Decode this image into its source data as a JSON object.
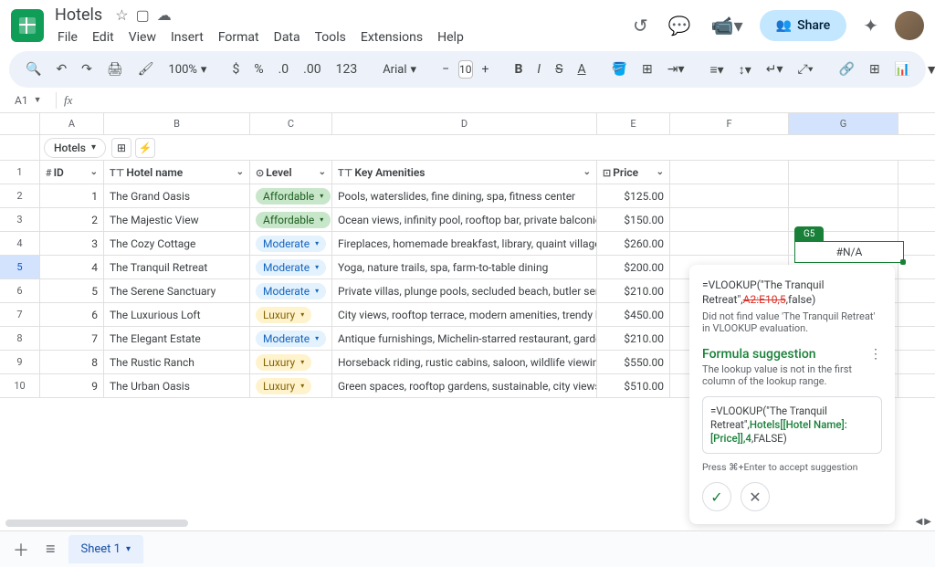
{
  "doc": {
    "title": "Hotels"
  },
  "menu": [
    "File",
    "Edit",
    "View",
    "Insert",
    "Format",
    "Data",
    "Tools",
    "Extensions",
    "Help"
  ],
  "topbar": {
    "share": "Share"
  },
  "toolbar": {
    "zoom": "100%",
    "font": "Arial",
    "fontsize": "10"
  },
  "namebox": {
    "ref": "A1"
  },
  "columns": [
    "A",
    "B",
    "C",
    "D",
    "E",
    "F",
    "G"
  ],
  "table_chip": "Hotels",
  "headers": {
    "id": "ID",
    "name": "Hotel name",
    "level": "Level",
    "amen": "Key Amenities",
    "price": "Price"
  },
  "rows": [
    {
      "n": "2",
      "id": "1",
      "name": "The Grand Oasis",
      "level": "Affordable",
      "lvl": "aff",
      "amen": "Pools, waterslides, fine dining, spa, fitness center",
      "price": "$125.00"
    },
    {
      "n": "3",
      "id": "2",
      "name": "The Majestic View",
      "level": "Affordable",
      "lvl": "aff",
      "amen": "Ocean views, infinity pool, rooftop bar, private balconies",
      "price": "$150.00"
    },
    {
      "n": "4",
      "id": "3",
      "name": "The Cozy Cottage",
      "level": "Moderate",
      "lvl": "mod",
      "amen": "Fireplaces, homemade breakfast, library, quaint village charm",
      "price": "$260.00"
    },
    {
      "n": "5",
      "id": "4",
      "name": "The Tranquil Retreat",
      "level": "Moderate",
      "lvl": "mod",
      "amen": "Yoga, nature trails, spa, farm-to-table dining",
      "price": "$200.00"
    },
    {
      "n": "6",
      "id": "5",
      "name": "The Serene Sanctuary",
      "level": "Moderate",
      "lvl": "mod",
      "amen": "Private villas, plunge pools, secluded beach, butler service",
      "price": "$210.00"
    },
    {
      "n": "7",
      "id": "6",
      "name": "The Luxurious Loft",
      "level": "Luxury",
      "lvl": "lux",
      "amen": "City views, rooftop terrace, modern amenities, trendy bar",
      "price": "$450.00"
    },
    {
      "n": "8",
      "id": "7",
      "name": "The Elegant Estate",
      "level": "Moderate",
      "lvl": "mod",
      "amen": "Antique furnishings, Michelin-starred restaurant, gardens",
      "price": "$210.00"
    },
    {
      "n": "9",
      "id": "8",
      "name": "The Rustic Ranch",
      "level": "Luxury",
      "lvl": "lux",
      "amen": "Horseback riding, rustic cabins, saloon, wildlife viewing",
      "price": "$550.00"
    },
    {
      "n": "10",
      "id": "9",
      "name": "The Urban Oasis",
      "level": "Luxury",
      "lvl": "lux",
      "amen": "Green spaces, rooftop gardens, sustainable, city views",
      "price": "$510.00"
    }
  ],
  "g5": {
    "tag": "G5",
    "value": "#N/A"
  },
  "popup": {
    "f_pre": "=VLOOKUP(\"The Tranquil Retreat\",",
    "f_strike": "A2:E10,5",
    "f_post": ",false)",
    "err": "Did not find value 'The Tranquil Retreat' in VLOOKUP evaluation.",
    "title": "Formula suggestion",
    "desc": "The lookup value is not in the first column of the lookup range.",
    "s_pre": "=VLOOKUP(\"The Tranquil Retreat\",",
    "s_grn": "Hotels[[Hotel Name]:[Price]],4",
    "s_post": ",FALSE)",
    "hint": "Press ⌘+Enter to accept suggestion"
  },
  "bottom": {
    "sheet": "Sheet 1"
  }
}
